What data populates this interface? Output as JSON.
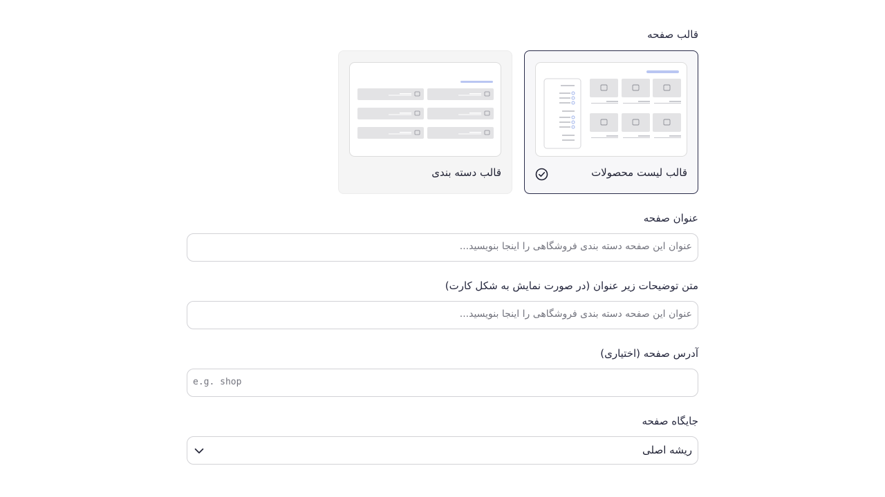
{
  "template_section": {
    "label": "قالب صفحه",
    "cards": [
      {
        "title": "قالب لیست محصولات",
        "selected": true,
        "check_icon": "check-circle-icon"
      },
      {
        "title": "قالب دسته بندی",
        "selected": false
      }
    ]
  },
  "page_title_field": {
    "label": "عنوان صفحه",
    "placeholder": "عنوان این صفحه دسته بندی فروشگاهی را اینجا بنویسید..."
  },
  "description_field": {
    "label": "متن توضیحات زیر عنوان (در صورت نمایش به شکل کارت)",
    "placeholder": "عنوان این صفحه دسته بندی فروشگاهی را اینجا بنویسید..."
  },
  "address_field": {
    "label": "آدرس صفحه (اختیاری)",
    "placeholder": "e.g. shop"
  },
  "position_field": {
    "label": "جایگاه صفحه",
    "value": "ریشه اصلی",
    "icon": "chevron-down-icon"
  },
  "colors": {
    "accent": "#2a2c4a",
    "thumb_highlight": "#b9c6f2",
    "placeholder_block": "#e3e3e5"
  }
}
